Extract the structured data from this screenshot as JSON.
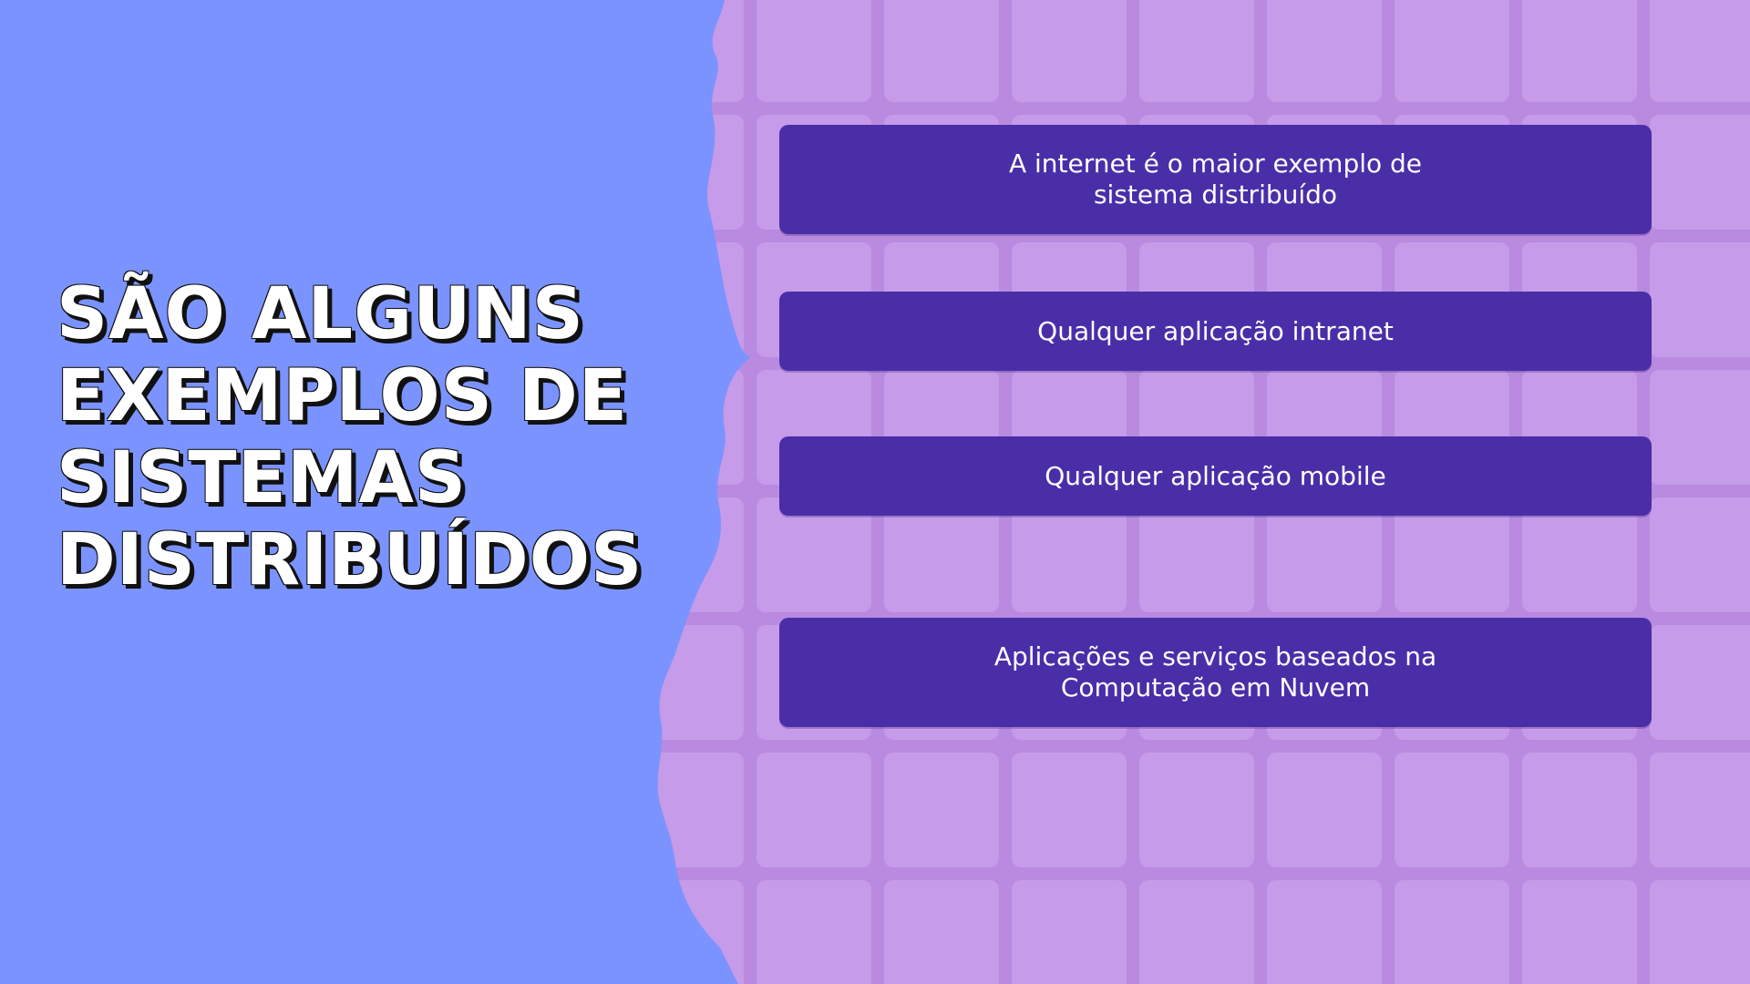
{
  "title": {
    "line1": "São alguns",
    "line2": "exemplos de",
    "line3": "sistemas",
    "line4": "distribuídos"
  },
  "items": [
    {
      "label": "A internet é o maior exemplo de sistema distribuído"
    },
    {
      "label": "Qualquer aplicação intranet"
    },
    {
      "label": "Qualquer aplicação mobile"
    },
    {
      "label": "Aplicações e serviços baseados na Computação em Nuvem"
    }
  ],
  "colors": {
    "left_background": "#7b93ff",
    "right_background": "#c69be9",
    "grid_lines": "#b98ae0",
    "item_background": "#4a2ea8",
    "title_text": "#ffffff",
    "title_shadow": "#111111"
  }
}
